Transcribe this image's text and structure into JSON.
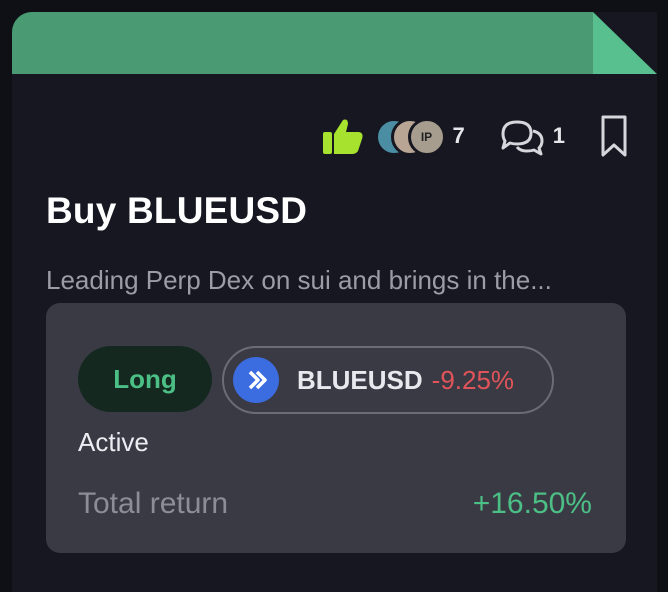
{
  "card": {
    "title": "Buy BLUEUSD",
    "description": "Leading Perp Dex on sui and brings in the...",
    "header_color": "#4a9a73"
  },
  "social": {
    "like_icon": "thumbs-up-icon",
    "avatar_initials": "IP",
    "like_count": "7",
    "comment_icon": "comment-icon",
    "comment_count": "1",
    "bookmark_icon": "bookmark-icon"
  },
  "position": {
    "direction": "Long",
    "asset_icon": "bluefin-logo-icon",
    "asset": "BLUEUSD",
    "change": "-9.25%",
    "status": "Active",
    "return_label": "Total return",
    "return_value": "+16.50%"
  },
  "colors": {
    "positive": "#4bbf85",
    "negative": "#e0545a",
    "like_icon": "#a6e22e"
  }
}
